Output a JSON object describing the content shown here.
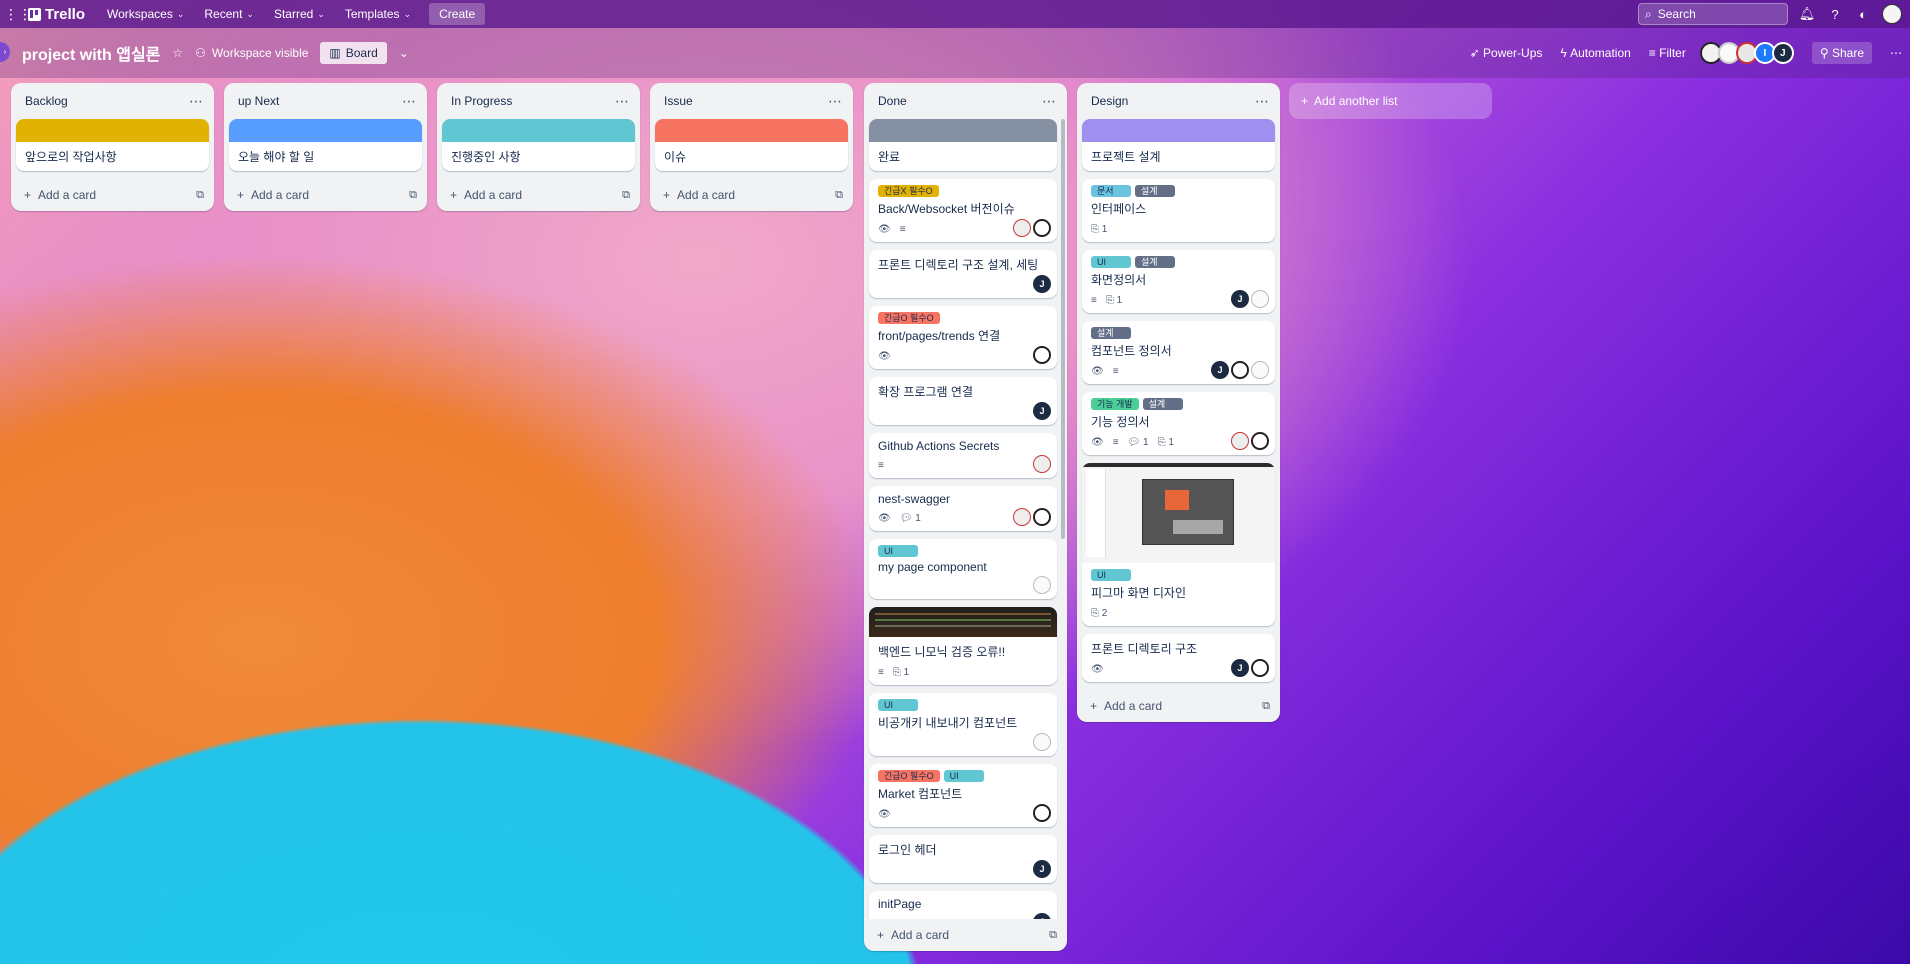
{
  "topbar": {
    "app_name": "Trello",
    "nav": [
      {
        "label": "Workspaces"
      },
      {
        "label": "Recent"
      },
      {
        "label": "Starred"
      },
      {
        "label": "Templates"
      }
    ],
    "create_label": "Create",
    "search_placeholder": "Search"
  },
  "board": {
    "title": "project with 앱실론",
    "visibility": "Workspace visible",
    "view": "Board",
    "power_ups": "Power-Ups",
    "automation": "Automation",
    "filter": "Filter",
    "share": "Share",
    "avatar_initials": [
      "",
      "",
      "",
      "I",
      "J"
    ]
  },
  "colors": {
    "yellow": "#e2b203",
    "blue": "#579dff",
    "teal": "#60c6d2",
    "red": "#f87462",
    "gray": "#8590a2",
    "purple": "#9f8fef",
    "label_green": "#4bce97",
    "label_dark": "#626f86",
    "label_teal": "#6cc3e0"
  },
  "add_card_label": "Add a card",
  "add_list_label": "Add another list",
  "lists": [
    {
      "title": "Backlog",
      "cards": [
        {
          "title": "앞으로의 작업사항"
        }
      ]
    },
    {
      "title": "up Next",
      "cards": [
        {
          "title": "오늘 해야 할 일"
        }
      ]
    },
    {
      "title": "In Progress",
      "cards": [
        {
          "title": "진행중인 사항"
        }
      ]
    },
    {
      "title": "Issue",
      "cards": [
        {
          "title": "이슈"
        }
      ]
    },
    {
      "title": "Done",
      "cards": [
        {
          "title": "완료"
        },
        {
          "title": "Back/Websocket 버전이슈",
          "labels": [
            "긴급X 필수O"
          ]
        },
        {
          "title": "프론트 디렉토리 구조 설계, 세팅",
          "member": "J"
        },
        {
          "title": "front/pages/trends 연결",
          "labels": [
            "긴급O 필수O"
          ]
        },
        {
          "title": "확장 프로그램 연결",
          "member": "J"
        },
        {
          "title": "Github Actions Secrets"
        },
        {
          "title": "nest-swagger",
          "comments": "1"
        },
        {
          "title": "my page component",
          "labels": [
            "UI"
          ]
        },
        {
          "title": "백엔드 니모닉 검증 오류!!",
          "attachments": "1"
        },
        {
          "title": "비공개키 내보내기 컴포넌트",
          "labels": [
            "UI"
          ]
        },
        {
          "title": "Market 컴포넌트",
          "labels": [
            "긴급O 필수O",
            "UI"
          ]
        },
        {
          "title": "로그인 헤더",
          "member": "J"
        },
        {
          "title": "initPage",
          "member": "J"
        }
      ]
    },
    {
      "title": "Design",
      "cards": [
        {
          "title": "프로젝트 설계"
        },
        {
          "title": "인터페이스",
          "labels": [
            "문서",
            "설계"
          ],
          "attachments": "1"
        },
        {
          "title": "화면정의서",
          "labels": [
            "UI",
            "설계"
          ],
          "attachments": "1",
          "member": "J"
        },
        {
          "title": "컴포넌트 정의서",
          "labels": [
            "설계"
          ],
          "member": "J"
        },
        {
          "title": "기능 정의서",
          "labels": [
            "기능 개발",
            "설계"
          ],
          "comments": "1",
          "attachments": "1"
        },
        {
          "title": "피그마 화면 디자인",
          "labels": [
            "UI"
          ],
          "attachments": "2"
        },
        {
          "title": "프론트 디렉토리 구조",
          "member": "J"
        }
      ]
    }
  ]
}
